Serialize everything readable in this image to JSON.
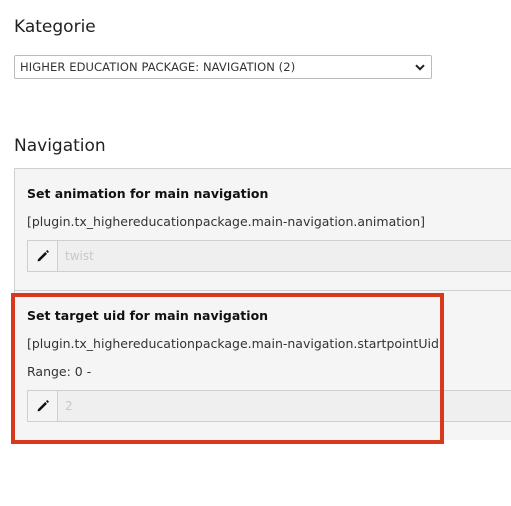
{
  "category": {
    "heading": "Kategorie",
    "selected": "HIGHER EDUCATION PACKAGE: NAVIGATION (2)"
  },
  "navigation": {
    "heading": "Navigation",
    "fields": [
      {
        "label": "Set animation for main navigation",
        "path": "[plugin.tx_highereducationpackage.main-navigation.animation]",
        "value": "twist"
      },
      {
        "label": "Set target uid for main navigation",
        "path": "[plugin.tx_highereducationpackage.main-navigation.startpointUid]",
        "range": "Range: 0 -",
        "value": "2"
      }
    ]
  },
  "colors": {
    "highlight": "#d8381c"
  },
  "icons": {
    "edit": "pencil-icon",
    "dropdown": "chevron-down-icon"
  }
}
